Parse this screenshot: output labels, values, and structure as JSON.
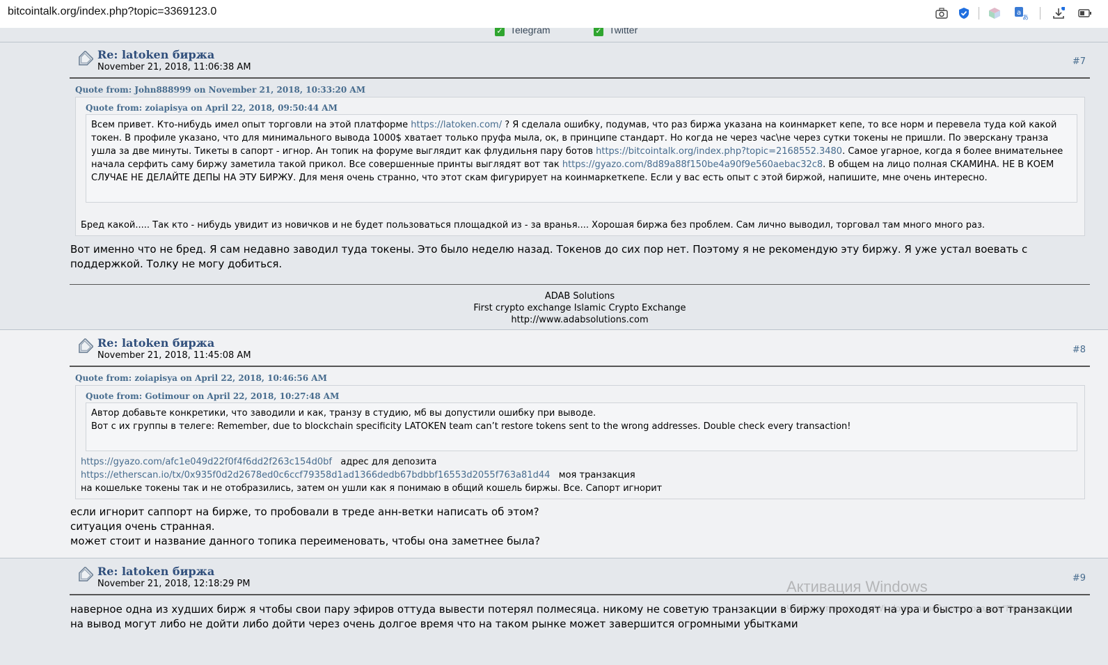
{
  "browser": {
    "url": "bitcointalk.org/index.php?topic=3369123.0",
    "icons": [
      "camera-icon",
      "shield-check-icon",
      "cube-icon",
      "translate-icon",
      "download-icon",
      "battery-icon"
    ]
  },
  "signature_top": {
    "items": [
      {
        "label": "Telegram"
      },
      {
        "label": "Twitter"
      }
    ]
  },
  "posts": [
    {
      "title": "Re: latoken биржа",
      "date": "November 21, 2018, 11:06:38 AM",
      "number": "#7",
      "quote_outer_header": "Quote from: John888999 on November 21, 2018, 10:33:20 AM",
      "quote_inner_header": "Quote from: zoiapisya on April 22, 2018, 09:50:44 AM",
      "quote_inner_parts": [
        {
          "t": "Всем привет. Кто-нибудь имел опыт торговли на этой платформе "
        },
        {
          "t": "https://latoken.com/",
          "link": true
        },
        {
          "t": " ? Я сделала ошибку, подумав, что раз биржа указана на коинмаркет кепе, то все норм и перевела туда кой какой токен. В профиле указано, что для минимального вывода 1000$ хватает только пруфа мыла, ок, в принципе стандарт. Но когда не через час\\не через сутки токены не пришли. По эверскану транза ушла за две минуты. Тикеты в сапорт - игнор. Ан топик на форуме выглядит как флудильня пару ботов "
        },
        {
          "t": "https://bitcointalk.org/index.php?topic=2168552.3480",
          "link": true
        },
        {
          "t": ". Самое угарное, когда я более внимательнее начала серфить саму биржу заметила такой прикол. Все совершенные принты выглядят вот так "
        },
        {
          "t": "https://gyazo.com/8d89a88f150be4a90f9e560aebac32c8",
          "link": true
        },
        {
          "t": ". В общем на лицо полная СКАМИНА. НЕ В КОЕМ СЛУЧАЕ НЕ ДЕЛАЙТЕ ДЕПЫ НА ЭТУ БИРЖУ. Для меня очень странно, что этот скам фигурирует на коинмаркеткепе. Если у вас есть опыт с этой биржой, напишите, мне очень интересно."
        }
      ],
      "quote_outer_text": "Бред какой..... Так кто - нибудь увидит из новичков и не будет пользоваться площадкой из - за вранья.... Хорошая биржа без проблем. Сам лично выводил, торговал там много много раз.",
      "body": "Вот именно что не бред. Я сам недавно заводил туда токены. Это было неделю назад. Токенов до сих пор нет. Поэтому я не рекомендую эту биржу. Я уже устал воевать с поддержкой. Толку не могу добиться.",
      "signature": [
        "ADAB Solutions",
        "First crypto exchange Islamic Crypto Exchange",
        "http://www.adabsolutions.com"
      ]
    },
    {
      "title": "Re: latoken биржа",
      "date": "November 21, 2018, 11:45:08 AM",
      "number": "#8",
      "quote_outer_header": "Quote from: zoiapisya on April 22, 2018, 10:46:56 AM",
      "quote_inner_header": "Quote from: Gotimour on April 22, 2018, 10:27:48 AM",
      "quote_inner_lines": [
        "Автор добавьте конкретики, что заводили и как, транзу в студию, мб вы допустили ошибку при выводе.",
        "Вот с их группы в телеге: Remember, due to blockchain specificity LATOKEN team can’t restore tokens sent to the wrong addresses. Double check every transaction!"
      ],
      "quote_outer_lines": [
        {
          "link": "https://gyazo.com/afc1e049d22f0f4f6dd2f263c154d0bf",
          "text": "адрес для депозита"
        },
        {
          "link": "https://etherscan.io/tx/0x935f0d2d2678ed0c6ccf79358d1ad1366dedb67bdbbf16553d2055f763a81d44",
          "text": "моя транзакция"
        },
        {
          "link": "",
          "text": "на кошельке токены так и не отобразились, затем он ушли как я понимаю в общий кошель биржы. Все. Сапорт игнорит"
        }
      ],
      "body_lines": [
        "если игнорит саппорт на бирже, то пробовали в треде анн-ветки написать об этом?",
        "ситуация очень странная.",
        "может стоит и название данного топика переименовать, чтобы она заметнее была?"
      ]
    },
    {
      "title": "Re: latoken биржа",
      "date": "November 21, 2018, 12:18:29 PM",
      "number": "#9",
      "body": "наверное одна из худших бирж я чтобы свои пару эфиров оттуда вывести потерял полмесяца. никому не советую транзакции в биржу проходят на ура и быстро а вот транзакции на вывод могут либо не дойти либо дойти через очень долгое время что на таком рынке может завершится огромными убытками"
    }
  ],
  "watermark": {
    "title": "Активация Windows",
    "subtitle": "Чтобы активировать Windows, перейдите в раздел \"Параметры\"."
  }
}
